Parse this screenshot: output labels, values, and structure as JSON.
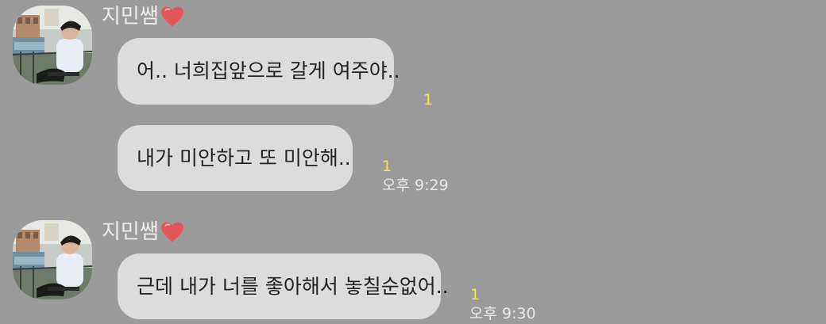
{
  "groups": [
    {
      "sender": {
        "name": "지민쌤",
        "icon": "heart-icon"
      },
      "messages": [
        {
          "text": "어.. 너희집앞으로 갈게 여주야..",
          "unread": "1"
        },
        {
          "text": "내가 미안하고 또 미안해..",
          "unread": "1",
          "time": "오후 9:29"
        }
      ]
    },
    {
      "sender": {
        "name": "지민쌤",
        "icon": "heart-icon"
      },
      "messages": [
        {
          "text": "근데 내가 너를 좋아해서 놓칠순없어..",
          "unread": "1",
          "time": "오후 9:30"
        }
      ]
    }
  ],
  "colors": {
    "background": "#9b9b9b",
    "bubble": "#dcdcdc",
    "unread": "#f2ea2a",
    "heart": "#e0565a"
  }
}
